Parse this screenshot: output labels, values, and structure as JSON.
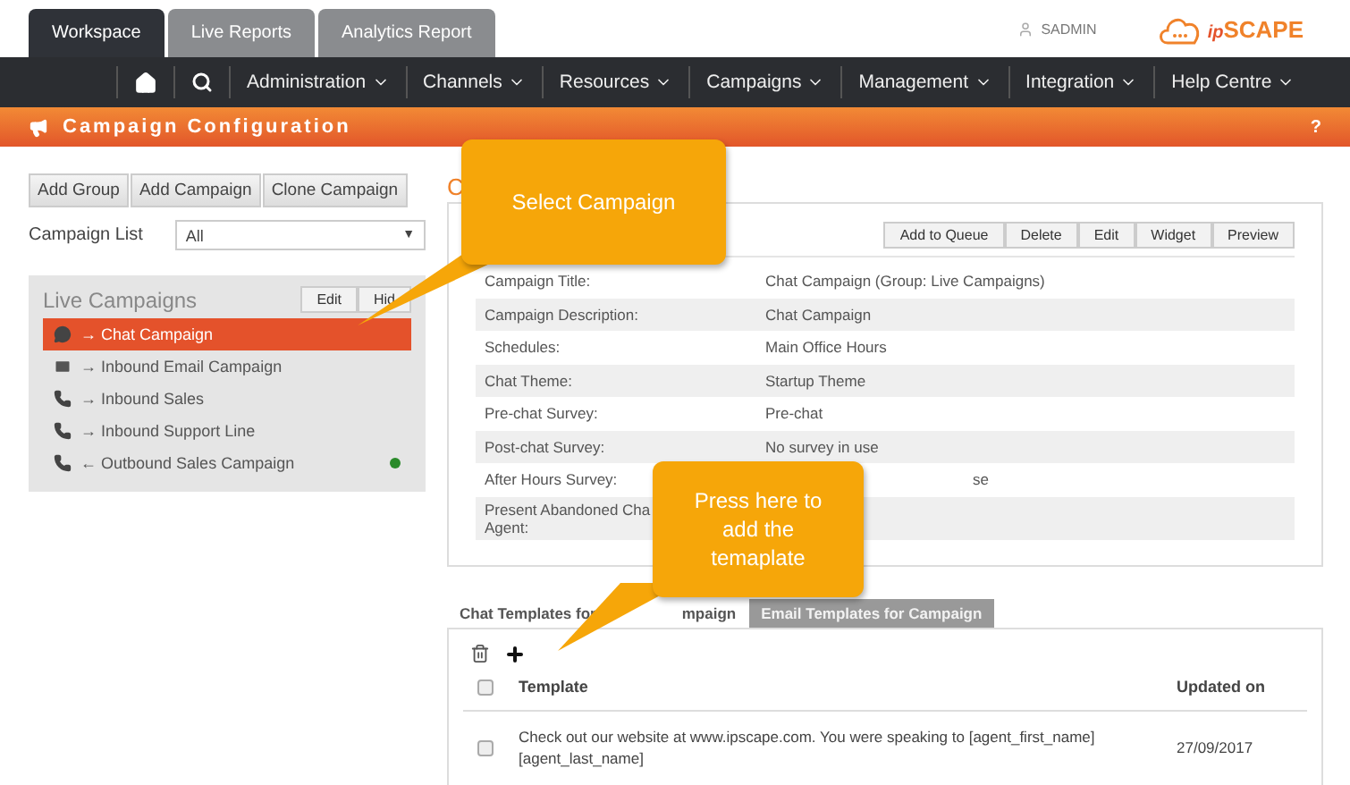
{
  "top_tabs": [
    {
      "label": "Workspace",
      "selected": true
    },
    {
      "label": "Live Reports",
      "selected": false
    },
    {
      "label": "Analytics Report",
      "selected": false
    }
  ],
  "user": "SADMIN",
  "logo_prefix": "ip",
  "logo": "SCAPE",
  "nav": [
    "Administration",
    "Channels",
    "Resources",
    "Campaigns",
    "Management",
    "Integration",
    "Help Centre"
  ],
  "page_title": "Campaign Configuration",
  "help": "?",
  "left": {
    "buttons": [
      "Add Group",
      "Add Campaign",
      "Clone Campaign"
    ],
    "list_label": "Campaign List",
    "list_value": "All",
    "list_caret": "▼",
    "group": {
      "title": "Live Campaigns",
      "buttons": [
        "Edit",
        "Hid"
      ],
      "items": [
        {
          "kind": "chat",
          "direction": "→",
          "name": "Chat Campaign",
          "selected": true,
          "online": false
        },
        {
          "kind": "email",
          "direction": "→",
          "name": "Inbound Email Campaign",
          "selected": false,
          "online": false
        },
        {
          "kind": "phone",
          "direction": "→",
          "name": "Inbound Sales",
          "selected": false,
          "online": false
        },
        {
          "kind": "phone",
          "direction": "→",
          "name": "Inbound Support Line",
          "selected": false,
          "online": false
        },
        {
          "kind": "phone",
          "direction": "←",
          "name": "Outbound Sales Campaign",
          "selected": false,
          "online": true
        }
      ]
    }
  },
  "detail": {
    "title": "C",
    "buttons": [
      "Add to Queue",
      "Delete",
      "Edit",
      "Widget",
      "Preview"
    ],
    "rows": [
      {
        "label": "Campaign Title:",
        "value": "Chat Campaign (Group: Live Campaigns)"
      },
      {
        "label": "Campaign Description:",
        "value": "Chat Campaign"
      },
      {
        "label": "Schedules:",
        "value": "Main Office Hours"
      },
      {
        "label": "Chat Theme:",
        "value": "Startup Theme"
      },
      {
        "label": "Pre-chat Survey:",
        "value": "Pre-chat"
      },
      {
        "label": "Post-chat Survey:",
        "value": "No survey in use"
      },
      {
        "label": "After Hours Survey:",
        "value": "se"
      },
      {
        "label": "Present Abandoned Cha",
        "label_2": "Agent:",
        "value": ""
      }
    ]
  },
  "templates": {
    "tabs": [
      {
        "label": "Chat Templates for",
        "label_end": "mpaign",
        "selected": true
      },
      {
        "label": "Email Templates for Campaign",
        "selected": false
      }
    ],
    "columns": [
      "Template",
      "Updated on"
    ],
    "select_all_checked": false,
    "rows": [
      {
        "text": "Check out our website at www.ipscape.com. You were speaking to [agent_first_name] [agent_last_name]",
        "date": "27/09/2017",
        "checked": false
      }
    ]
  },
  "callouts": [
    "Select Campaign",
    "Press here to add the temaplate"
  ]
}
